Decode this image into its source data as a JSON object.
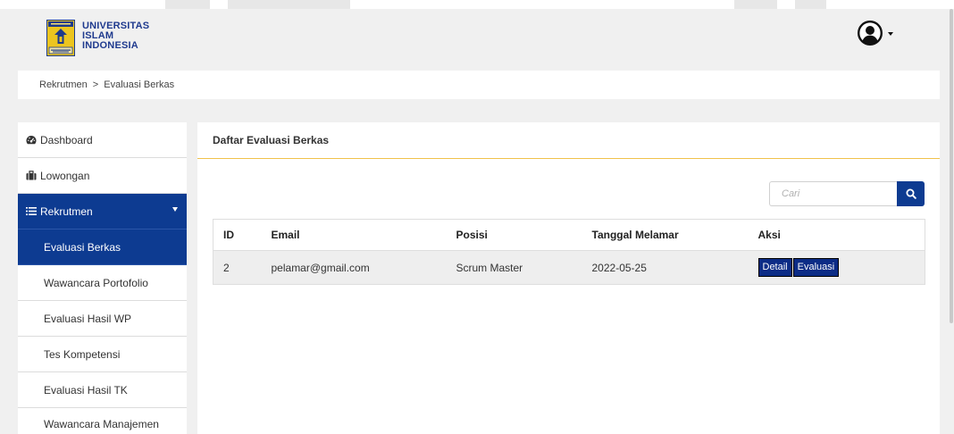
{
  "app": {
    "logo_lines": [
      "UNIVERSITAS",
      "ISLAM",
      "INDONESIA"
    ],
    "logo_icon": "university-crest-icon",
    "user_icon": "user-circle-icon",
    "user_caret_icon": "caret-down-icon"
  },
  "theme": {
    "primary": "#0d3b91",
    "accent": "#f0c24b",
    "page_bg": "#f0f0f0",
    "action_button": "#0c2c86"
  },
  "breadcrumb": {
    "items": [
      "Rekrutmen",
      "Evaluasi Berkas"
    ],
    "separator": ">"
  },
  "sidebar": {
    "items": [
      {
        "label": "Dashboard",
        "icon": "dashboard-icon"
      },
      {
        "label": "Lowongan",
        "icon": "briefcase-icon"
      },
      {
        "label": "Rekrutmen",
        "icon": "list-icon",
        "expanded": true,
        "active": true
      }
    ],
    "submenu": [
      {
        "label": "Evaluasi Berkas",
        "active": true
      },
      {
        "label": "Wawancara Portofolio"
      },
      {
        "label": "Evaluasi Hasil WP"
      },
      {
        "label": "Tes Kompetensi"
      },
      {
        "label": "Evaluasi Hasil TK"
      },
      {
        "label": "Wawancara Manajemen"
      }
    ]
  },
  "main": {
    "title": "Daftar Evaluasi Berkas",
    "search": {
      "placeholder": "Cari",
      "value": "",
      "button_icon": "search-icon"
    },
    "table": {
      "columns": [
        "ID",
        "Email",
        "Posisi",
        "Tanggal Melamar",
        "Aksi"
      ],
      "rows": [
        {
          "id": "2",
          "email": "pelamar@gmail.com",
          "posisi": "Scrum Master",
          "tanggal_melamar": "2022-05-25",
          "actions": [
            "Detail",
            "Evaluasi"
          ]
        }
      ]
    }
  }
}
